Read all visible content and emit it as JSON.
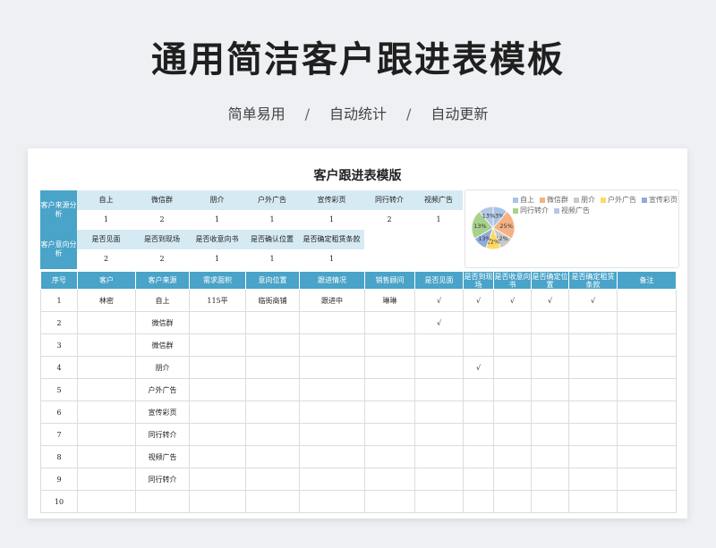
{
  "header": {
    "title": "通用简洁客户跟进表模板",
    "sub1": "简单易用",
    "sub2": "自动统计",
    "sub3": "自动更新",
    "sep": "/"
  },
  "sheet": {
    "title": "客户跟进表模版"
  },
  "source_table": {
    "label": "客户来源分析",
    "headers": [
      "自上",
      "微信群",
      "朋介",
      "户外广告",
      "宣传彩页",
      "同行转介",
      "视频广告"
    ],
    "values": [
      "1",
      "2",
      "1",
      "1",
      "1",
      "2",
      "1"
    ]
  },
  "intent_table": {
    "label": "客户意向分析",
    "headers": [
      "是否见面",
      "是否到现场",
      "是否收意向书",
      "是否确认位置",
      "是否确定租赁条款"
    ],
    "values": [
      "2",
      "2",
      "1",
      "1",
      "1"
    ]
  },
  "chart_data": {
    "type": "pie",
    "categories": [
      "自上",
      "微信群",
      "朋介",
      "户外广告",
      "宣传彩页",
      "同行转介",
      "视频广告"
    ],
    "values": [
      1,
      2,
      1,
      1,
      1,
      2,
      1
    ],
    "labels": [
      "13%",
      "25%",
      "12%",
      "12%",
      "13%",
      "13%",
      "13%"
    ],
    "colors": [
      "#a8c4e6",
      "#f4b183",
      "#c9c9c9",
      "#ffd966",
      "#8faadc",
      "#a9d18e",
      "#b4c7e7"
    ],
    "title": ""
  },
  "main_table": {
    "columns": [
      "序号",
      "客户",
      "客户来源",
      "需求面积",
      "意向位置",
      "跟进情况",
      "销售顾问",
      "是否见面",
      "是否到现场",
      "是否收意向书",
      "是否确定位置",
      "是否确定租赁条款",
      "备注"
    ],
    "rows": [
      [
        "1",
        "林密",
        "自上",
        "115平",
        "临街商铺",
        "跟进中",
        "琳琳",
        "√",
        "√",
        "√",
        "√",
        "√",
        ""
      ],
      [
        "2",
        "",
        "微信群",
        "",
        "",
        "",
        "",
        "√",
        "",
        "",
        "",
        "",
        ""
      ],
      [
        "3",
        "",
        "微信群",
        "",
        "",
        "",
        "",
        "",
        "",
        "",
        "",
        "",
        ""
      ],
      [
        "4",
        "",
        "朋介",
        "",
        "",
        "",
        "",
        "",
        "√",
        "",
        "",
        "",
        ""
      ],
      [
        "5",
        "",
        "户外广告",
        "",
        "",
        "",
        "",
        "",
        "",
        "",
        "",
        "",
        ""
      ],
      [
        "6",
        "",
        "宣传彩页",
        "",
        "",
        "",
        "",
        "",
        "",
        "",
        "",
        "",
        ""
      ],
      [
        "7",
        "",
        "同行转介",
        "",
        "",
        "",
        "",
        "",
        "",
        "",
        "",
        "",
        ""
      ],
      [
        "8",
        "",
        "视频广告",
        "",
        "",
        "",
        "",
        "",
        "",
        "",
        "",
        "",
        ""
      ],
      [
        "9",
        "",
        "同行转介",
        "",
        "",
        "",
        "",
        "",
        "",
        "",
        "",
        "",
        ""
      ],
      [
        "10",
        "",
        "",
        "",
        "",
        "",
        "",
        "",
        "",
        "",
        "",
        "",
        ""
      ]
    ]
  }
}
